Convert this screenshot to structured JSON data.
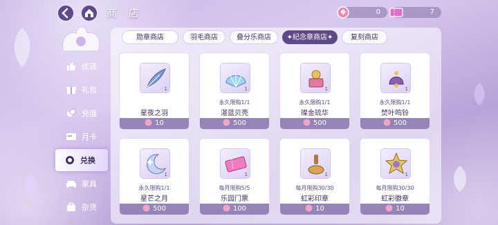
{
  "header": {
    "title": "商 店",
    "currencies": [
      {
        "icon": "pink-gem-icon",
        "value": "0"
      },
      {
        "icon": "ticket-icon",
        "value": "7"
      }
    ]
  },
  "sidebar": {
    "items": [
      {
        "label": "优选",
        "icon": "thumbs-up-icon",
        "active": false
      },
      {
        "label": "礼包",
        "icon": "gift-icon",
        "active": false
      },
      {
        "label": "充值",
        "icon": "coins-icon",
        "active": false
      },
      {
        "label": "月卡",
        "icon": "vip-card-icon",
        "active": false
      },
      {
        "label": "兑换",
        "icon": "exchange-icon",
        "active": true
      },
      {
        "label": "家具",
        "icon": "sofa-icon",
        "active": false
      },
      {
        "label": "杂货",
        "icon": "bag-icon",
        "active": false
      }
    ]
  },
  "tabs": [
    {
      "label": "勋章商店",
      "active": false
    },
    {
      "label": "羽毛商店",
      "active": false
    },
    {
      "label": "叠分乐商店",
      "active": false
    },
    {
      "label": "✦纪念章商店✦",
      "active": true
    },
    {
      "label": "复刻商店",
      "active": false
    }
  ],
  "items": [
    {
      "name": "星夜之羽",
      "limit": "",
      "qty": "1",
      "price": "10",
      "icon": "feather-icon"
    },
    {
      "name": "湛蓝贝壳",
      "limit": "永久限购1/1",
      "qty": "1",
      "price": "500",
      "icon": "shell-icon"
    },
    {
      "name": "璨金琉华",
      "limit": "永久限购1/1",
      "qty": "1",
      "price": "500",
      "icon": "gold-ornament-icon"
    },
    {
      "name": "焚叶鸣铃",
      "limit": "永久限购1/1",
      "qty": "1",
      "price": "500",
      "icon": "bell-icon"
    },
    {
      "name": "星芒之月",
      "limit": "永久限购1/1",
      "qty": "1",
      "price": "500",
      "icon": "moon-icon"
    },
    {
      "name": "乐园门票",
      "limit": "每月限购5/5",
      "qty": "1",
      "price": "100",
      "icon": "ticket-icon"
    },
    {
      "name": "虹彩印章",
      "limit": "每月限购30/30",
      "qty": "1",
      "price": "10",
      "icon": "seal-stamp-icon"
    },
    {
      "name": "虹彩徽章",
      "limit": "每月限购30/30",
      "qty": "1",
      "price": "10",
      "icon": "star-badge-icon"
    }
  ],
  "colors": {
    "accent": "#5e4a86",
    "price_bar": "#9584b8",
    "background": "#c8b6e6"
  }
}
